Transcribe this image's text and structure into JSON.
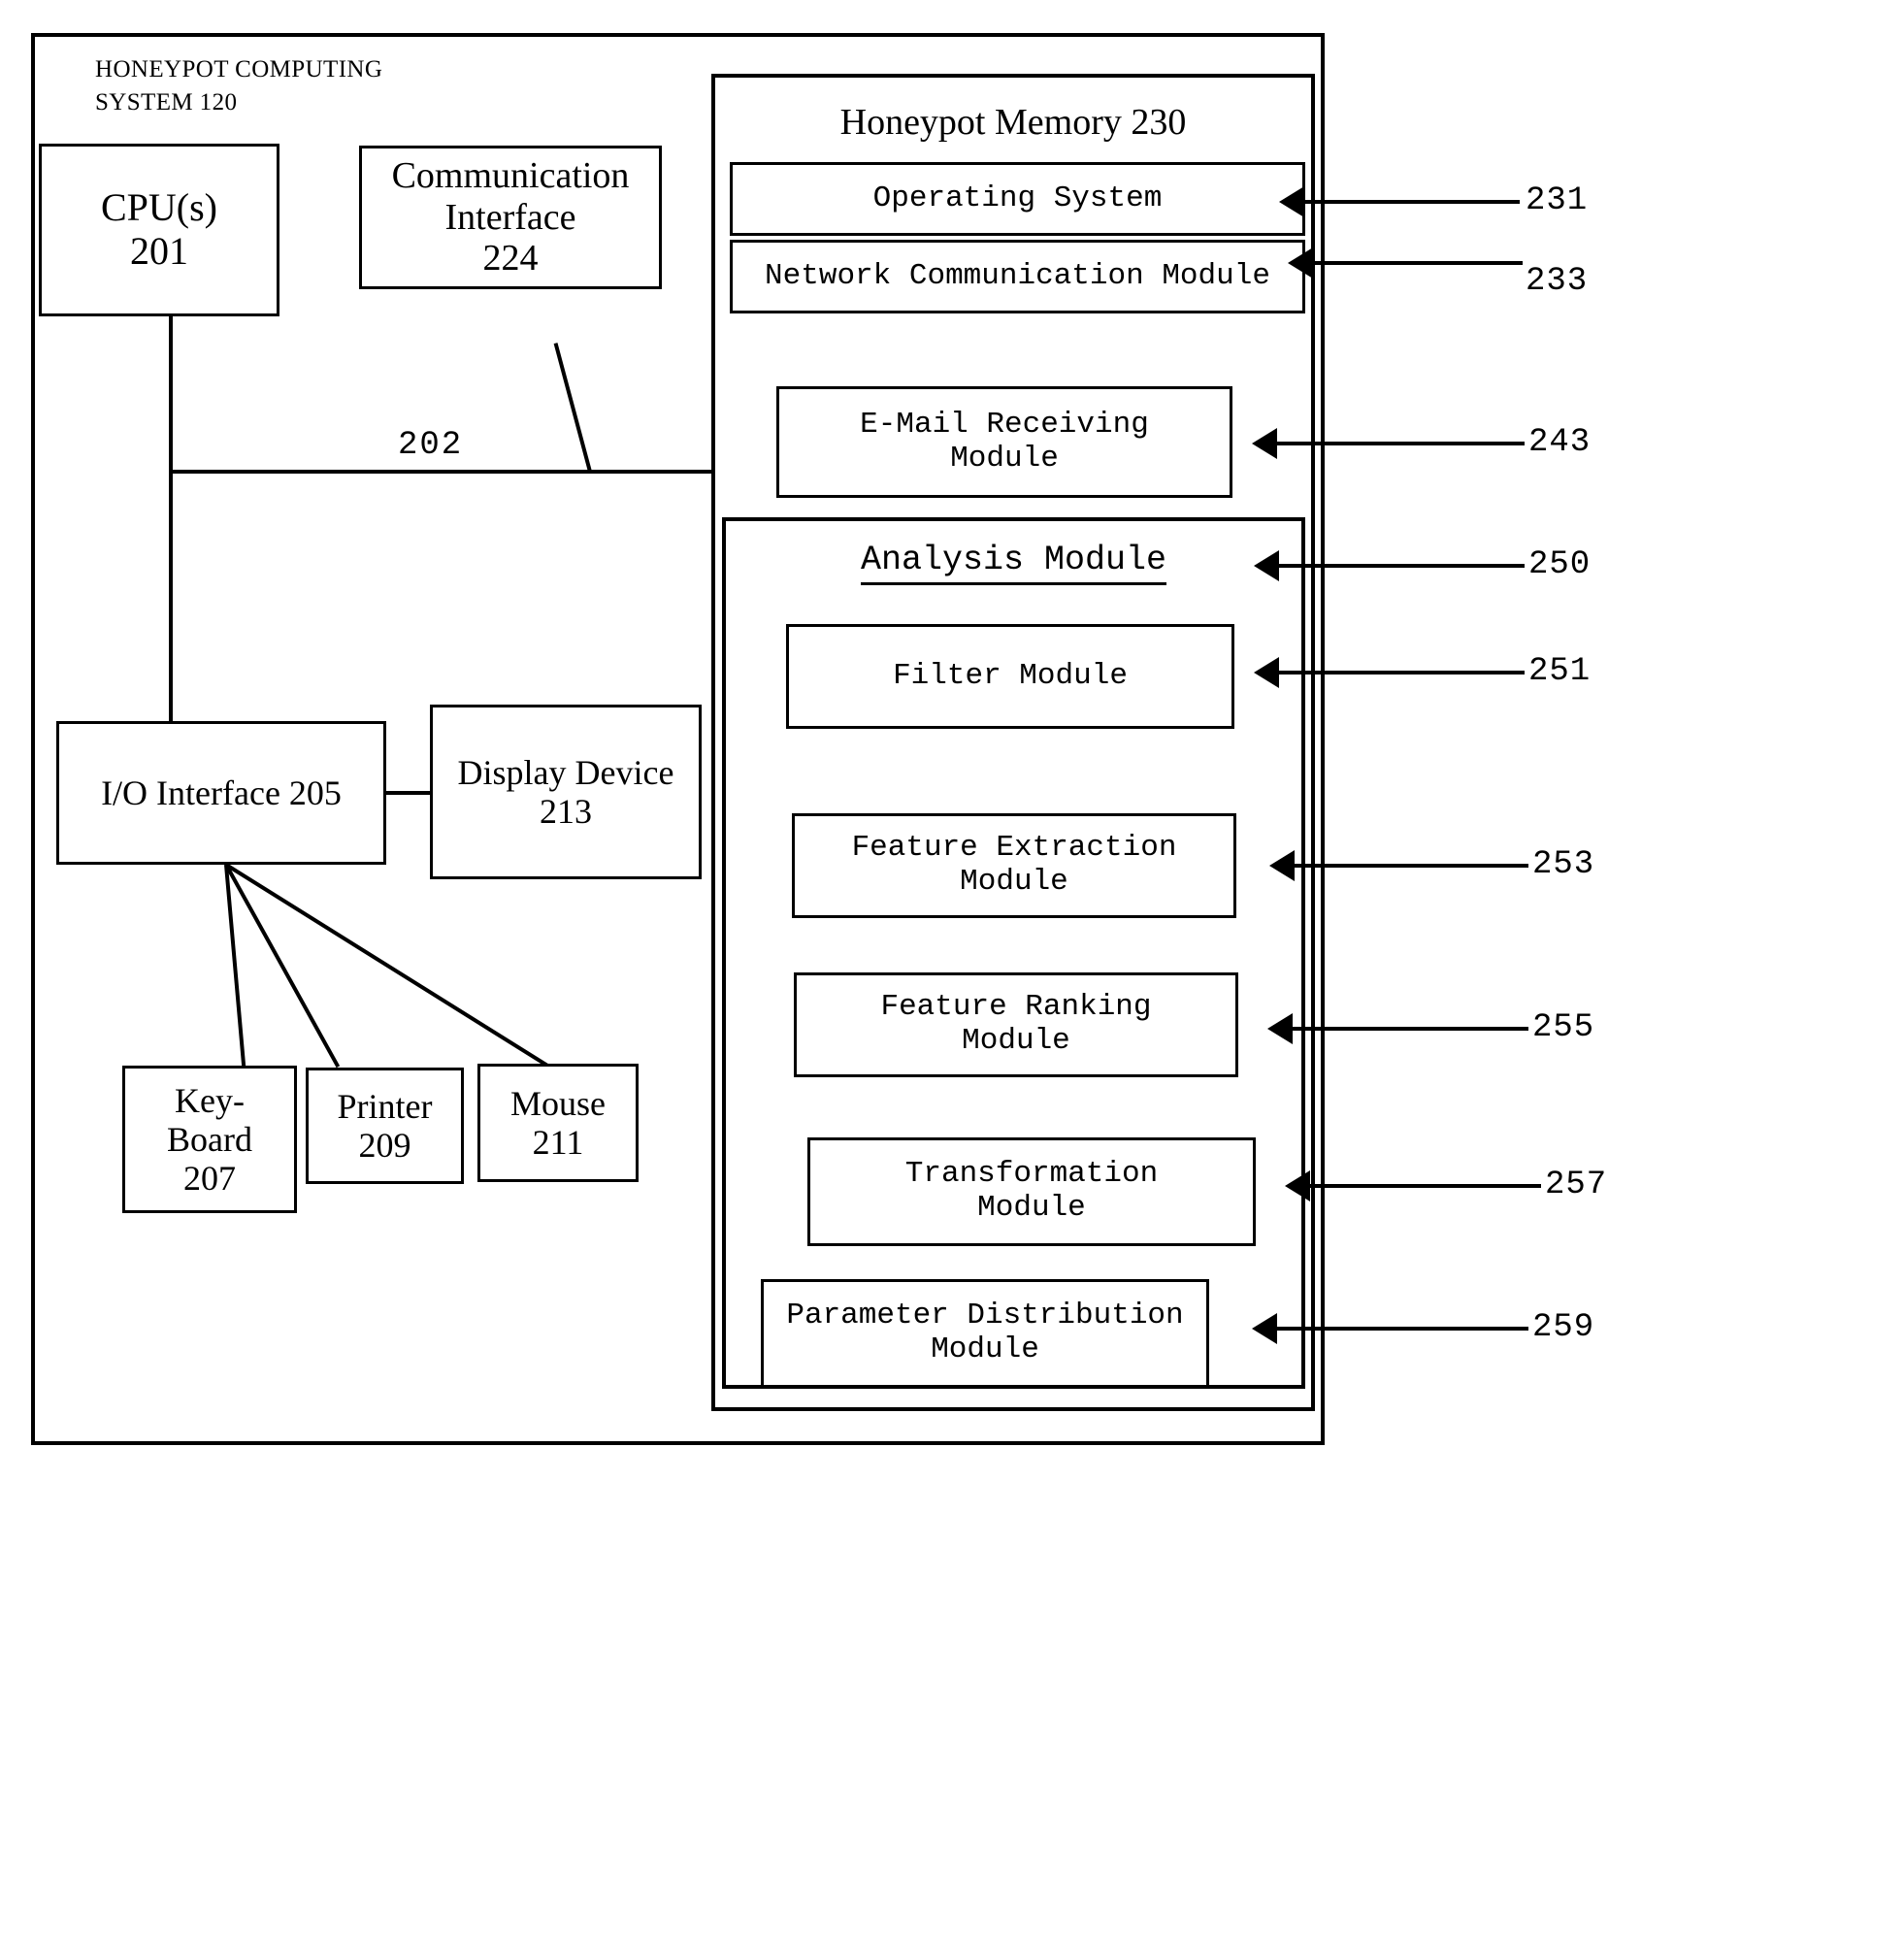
{
  "figure": {
    "system_title": "HONEYPOT COMPUTING\nSYSTEM  120",
    "bus_label": "202"
  },
  "hardware": {
    "cpu": "CPU(s)\n201",
    "communication_interface": "Communication\nInterface\n224",
    "io_interface": "I/O Interface 205",
    "display_device": "Display Device\n213",
    "keyboard": "Key-\nBoard\n207",
    "printer": "Printer\n209",
    "mouse": "Mouse\n211"
  },
  "memory": {
    "title": "Honeypot  Memory 230",
    "modules": {
      "operating_system": "Operating System",
      "network_communication": "Network Communication Module",
      "email_receiving": "E-Mail Receiving\nModule"
    }
  },
  "analysis_module": {
    "title": "Analysis Module",
    "modules": {
      "filter": "Filter Module",
      "feature_extraction": "Feature Extraction\nModule",
      "feature_ranking": "Feature Ranking\nModule",
      "transformation": "Transformation\nModule",
      "parameter_distribution": "Parameter Distribution\nModule"
    }
  },
  "reference_numerals": {
    "operating_system": "231",
    "network_communication": "233",
    "email_receiving": "243",
    "analysis_module": "250",
    "filter": "251",
    "feature_extraction": "253",
    "feature_ranking": "255",
    "transformation": "257",
    "parameter_distribution": "259"
  }
}
